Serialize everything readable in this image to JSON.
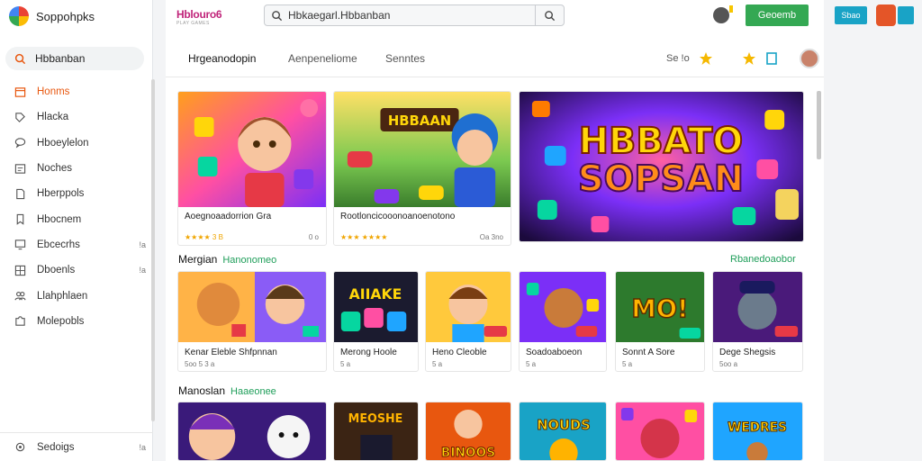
{
  "sidebar": {
    "brand": "Soppohpks",
    "search_label": "Hbbanban",
    "items": [
      {
        "label": "Honms",
        "icon": "home-icon",
        "active": true
      },
      {
        "label": "Hlacka",
        "icon": "tag-icon"
      },
      {
        "label": "Hboeylelon",
        "icon": "chat-icon"
      },
      {
        "label": "Noches",
        "icon": "list-icon"
      },
      {
        "label": "Hberppols",
        "icon": "doc-icon"
      },
      {
        "label": "Hbocnem",
        "icon": "bookmark-icon"
      },
      {
        "label": "Ebcecrhs",
        "icon": "monitor-icon",
        "count": "!a"
      },
      {
        "label": "Dboenls",
        "icon": "grid-icon",
        "count": "!a"
      },
      {
        "label": "Llahphlaen",
        "icon": "people-icon"
      },
      {
        "label": "Molepobls",
        "icon": "puzzle-icon"
      }
    ],
    "footer": {
      "label": "Sedoigs",
      "icon": "settings-icon",
      "count": "!a"
    }
  },
  "header": {
    "logo": "Hblouro6",
    "logo_sub": "PLAY GAMES",
    "search_query": "Hbkaegarl.Hbbanban",
    "account_button": "Geoemb"
  },
  "tabs": {
    "items": [
      "Hrgeanodopin",
      "Aenpeneliome",
      "Senntes"
    ],
    "right_label": "Se !o"
  },
  "featured": [
    {
      "title": "Aoegnoaadorrion Gra",
      "rating": "★★★★ 3 B",
      "right": "0 o"
    },
    {
      "title": "Rootloncicooonoanoenotono",
      "rating": "★★★ ★★★★",
      "right": "Oa 3no",
      "banner": "HBBAAN"
    },
    {
      "banner_line1": "HBBATO",
      "banner_line2": "SOPSAN"
    }
  ],
  "section1": {
    "title": "Mergian",
    "accent": "Hanonomeo",
    "link": "Rbanedoaobor",
    "cards": [
      {
        "title": "Kenar Eleble Shfpnnan",
        "sub": "5oo  5 3 a"
      },
      {
        "title": "Merong Hoole",
        "sub": "5 a",
        "art": "AIIAKE"
      },
      {
        "title": "Heno Cleoble",
        "sub": "5 a"
      },
      {
        "title": "Soadoaboeon",
        "sub": "5 a"
      },
      {
        "title": "Sonnt A Sore",
        "sub": "5 a",
        "art": "MO!"
      },
      {
        "title": "Dege Shegsis",
        "sub": "5oo a"
      }
    ]
  },
  "section2": {
    "title": "Manoslan",
    "accent": "Haaeonee",
    "cards": [
      {
        "art": ""
      },
      {
        "art": "MEOSHE"
      },
      {
        "art": "BINOOS"
      },
      {
        "art": "NOUDS"
      },
      {
        "art": ""
      },
      {
        "art": "WEDRES"
      }
    ]
  },
  "right_panel": {
    "button": "Sbao"
  },
  "colors": {
    "accent": "#e8570f",
    "green": "#34a853",
    "teal": "#19a3c6"
  }
}
